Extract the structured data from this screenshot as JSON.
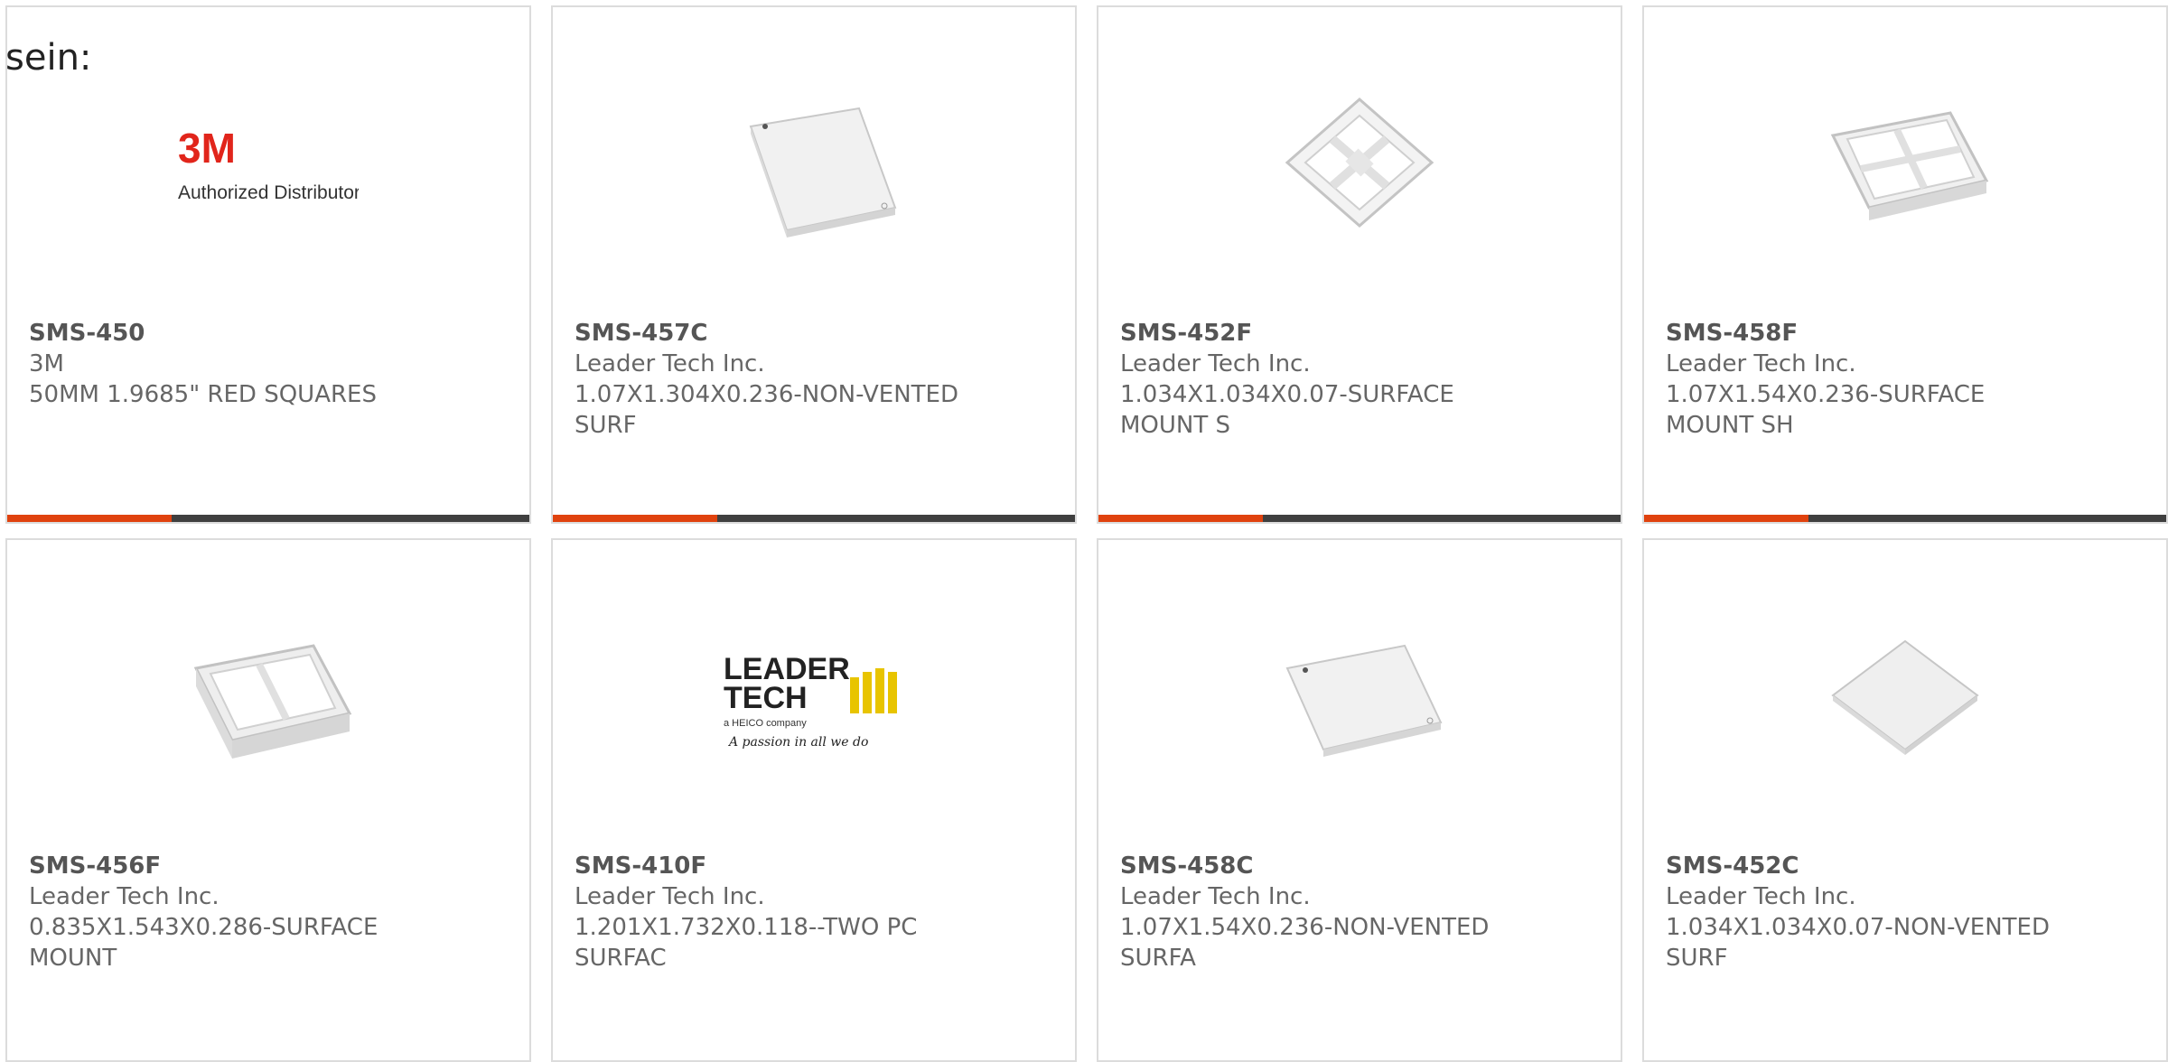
{
  "page": {
    "heading": "sein:"
  },
  "colors": {
    "accent": "#e0420e",
    "bar": "#3f3f3f",
    "brand_3m": "#e1251b",
    "leadertech_yellow": "#e8c400"
  },
  "products": [
    {
      "part": "SMS-450",
      "manufacturer": "3M",
      "description": "50MM 1.9685\" RED SQUARES",
      "image": "3m-logo",
      "logo_text": "Authorized Distributor"
    },
    {
      "part": "SMS-457C",
      "manufacturer": "Leader Tech Inc.",
      "description": "1.07X1.304X0.236-NON-VENTED SURF",
      "image": "shield-cover"
    },
    {
      "part": "SMS-452F",
      "manufacturer": "Leader Tech Inc.",
      "description": "1.034X1.034X0.07-SURFACE MOUNT S",
      "image": "shield-frame-square"
    },
    {
      "part": "SMS-458F",
      "manufacturer": "Leader Tech Inc.",
      "description": "1.07X1.54X0.236-SURFACE MOUNT SH",
      "image": "shield-frame-rect"
    },
    {
      "part": "SMS-456F",
      "manufacturer": "Leader Tech Inc.",
      "description": "0.835X1.543X0.286-SURFACE MOUNT",
      "image": "shield-frame-deep"
    },
    {
      "part": "SMS-410F",
      "manufacturer": "Leader Tech Inc.",
      "description": "1.201X1.732X0.118--TWO PC SURFAC",
      "image": "leadertech-logo",
      "logo_text": [
        "LEADER",
        "TECH",
        "a HEICO company",
        "A passion in all we do"
      ]
    },
    {
      "part": "SMS-458C",
      "manufacturer": "Leader Tech Inc.",
      "description": "1.07X1.54X0.236-NON-VENTED SURFA",
      "image": "shield-cover"
    },
    {
      "part": "SMS-452C",
      "manufacturer": "Leader Tech Inc.",
      "description": "1.034X1.034X0.07-NON-VENTED SURF",
      "image": "shield-cover-flat"
    }
  ]
}
